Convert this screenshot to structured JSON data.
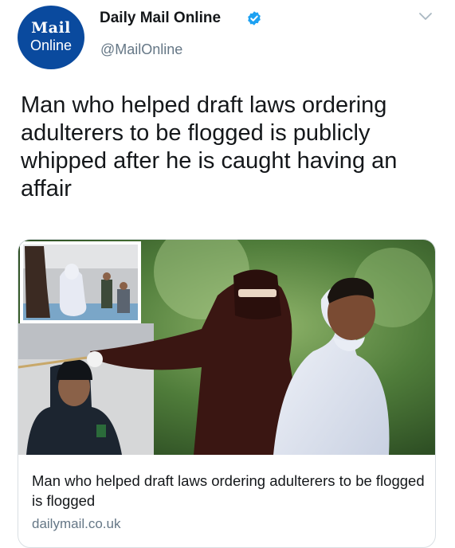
{
  "tweet": {
    "avatar": {
      "line1": "Mail",
      "line2": "Online"
    },
    "display_name": "Daily Mail Online",
    "handle": "@MailOnline",
    "text": "Man who helped draft laws ordering adulterers to be flogged is publicly whipped after he is caught having an affair"
  },
  "link_card": {
    "title": "Man who helped draft laws ordering adulterers to be flogged is flogged",
    "domain": "dailymail.co.uk"
  },
  "icons": {
    "verified": "verified-badge-icon",
    "menu": "chevron-down-icon"
  },
  "colors": {
    "brand_blue": "#0a4a9e",
    "verified_blue": "#1da1f2",
    "secondary_text": "#657786"
  }
}
